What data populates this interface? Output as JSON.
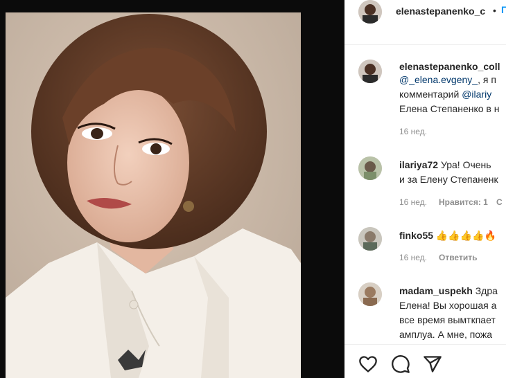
{
  "header": {
    "username": "elenastepanenko_c",
    "separator": "•",
    "follow": "П"
  },
  "caption": {
    "username": "elenastepanenko_coll",
    "mention1": "@_elena.evgeny_",
    "line1_rest": ", я п",
    "line2_text": "комментарий ",
    "mention2": "@ilariy",
    "line3": "Елена Степаненко в н",
    "time": "16 нед."
  },
  "comments": [
    {
      "username": "ilariya72",
      "text_line1": "Ура! Очень",
      "text_line2": "и за Елену Степаненк",
      "time": "16 нед.",
      "likes": "Нравится: 1",
      "reply": "С"
    },
    {
      "username": "finko55",
      "emoji": "👍👍👍👍🔥",
      "time": "16 нед.",
      "reply": "Ответить"
    },
    {
      "username": "madam_uspekh",
      "text_line1": "Здра",
      "text_line2": "Елена! Вы хорошая а",
      "text_line3": "все время вымткпает",
      "text_line4": "амплуа. А мне, пожа"
    }
  ],
  "actions": {
    "like_icon": "heart-icon",
    "comment_icon": "comment-icon",
    "share_icon": "send-icon"
  },
  "colors": {
    "link": "#00376b",
    "secondary": "#8e8e8e",
    "text": "#262626",
    "follow": "#0095f6"
  }
}
